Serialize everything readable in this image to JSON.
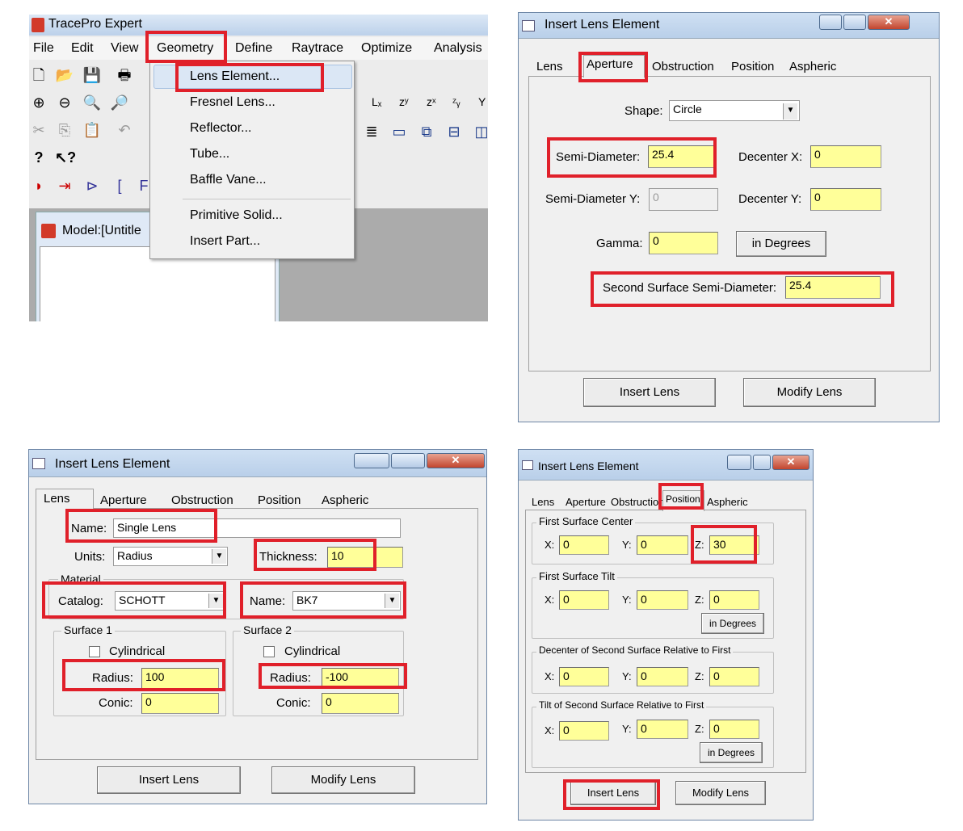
{
  "panel1": {
    "app_title": "TracePro Expert",
    "menu": [
      "File",
      "Edit",
      "View",
      "Geometry",
      "Define",
      "Raytrace",
      "Optimize",
      "Analysis"
    ],
    "geometry_menu_items": [
      "Lens Element...",
      "Fresnel Lens...",
      "Reflector...",
      "Tube...",
      "Baffle Vane...",
      "Primitive Solid...",
      "Insert Part..."
    ],
    "toolbar_glyphs": [
      "Lₓ",
      "zʸ",
      "zˣ",
      "ᶻᵧ",
      "Y"
    ],
    "model_title": "Model:[Untitle"
  },
  "panel2": {
    "title": "Insert Lens Element",
    "tabs": [
      "Lens",
      "Aperture",
      "Obstruction",
      "Position",
      "Aspheric"
    ],
    "shape_label": "Shape:",
    "shape_value": "Circle",
    "semi_diameter_label": "Semi-Diameter:",
    "semi_diameter_value": "25.4",
    "decenter_x_label": "Decenter X:",
    "decenter_x_value": "0",
    "semi_diameter_y_label": "Semi-Diameter Y:",
    "semi_diameter_y_value": "0",
    "decenter_y_label": "Decenter Y:",
    "decenter_y_value": "0",
    "gamma_label": "Gamma:",
    "gamma_value": "0",
    "degrees_button": "in Degrees",
    "second_surface_label": "Second Surface Semi-Diameter:",
    "second_surface_value": "25.4",
    "insert_button": "Insert Lens",
    "modify_button": "Modify Lens"
  },
  "panel3": {
    "title": "Insert Lens Element",
    "tabs": [
      "Lens",
      "Aperture",
      "Obstruction",
      "Position",
      "Aspheric"
    ],
    "name_label": "Name:",
    "name_value": "Single Lens",
    "units_label": "Units:",
    "units_value": "Radius",
    "thickness_label": "Thickness:",
    "thickness_value": "10",
    "material_label": "Material",
    "catalog_label": "Catalog:",
    "catalog_value": "SCHOTT",
    "mat_name_label": "Name:",
    "mat_name_value": "BK7",
    "surface1_label": "Surface 1",
    "surface2_label": "Surface 2",
    "cylindrical_label": "Cylindrical",
    "radius_label": "Radius:",
    "radius1_value": "100",
    "radius2_value": "-100",
    "conic_label": "Conic:",
    "conic1_value": "0",
    "conic2_value": "0",
    "insert_button": "Insert Lens",
    "modify_button": "Modify Lens"
  },
  "panel4": {
    "title": "Insert Lens Element",
    "tabs": [
      "Lens",
      "Aperture",
      "Obstruction",
      "Position",
      "Aspheric"
    ],
    "group1": "First Surface Center",
    "group2": "First Surface Tilt",
    "group3": "Decenter of Second Surface Relative to First",
    "group4": "Tilt of Second Surface Relative to First",
    "x_label": "X:",
    "y_label": "Y:",
    "z_label": "Z:",
    "g1_values": [
      "0",
      "0",
      "30"
    ],
    "g2_values": [
      "0",
      "0",
      "0"
    ],
    "g3_values": [
      "0",
      "0",
      "0"
    ],
    "g4_values": [
      "0",
      "0",
      "0"
    ],
    "degrees_button": "in Degrees",
    "insert_button": "Insert Lens",
    "modify_button": "Modify Lens"
  },
  "colors": {
    "highlight": "#e0202a",
    "field_yellow": "#ffff99",
    "dialog_bg": "#f0f0f0",
    "titlebar": "#c4d6ec"
  }
}
